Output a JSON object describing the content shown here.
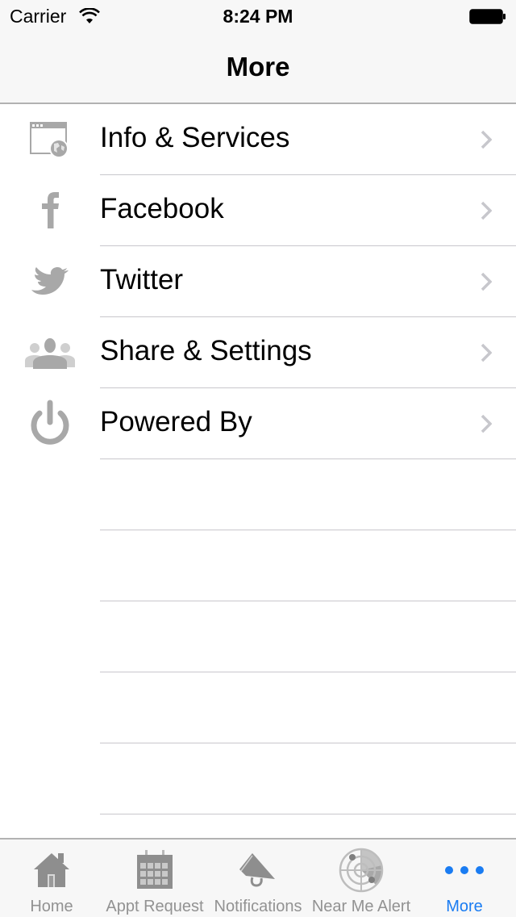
{
  "status_bar": {
    "carrier": "Carrier",
    "time": "8:24 PM",
    "wifi_icon": "wifi-icon",
    "battery_icon": "battery-icon"
  },
  "nav": {
    "title": "More"
  },
  "menu": {
    "items": [
      {
        "label": "Info & Services",
        "icon": "browser-globe-icon"
      },
      {
        "label": "Facebook",
        "icon": "facebook-icon"
      },
      {
        "label": "Twitter",
        "icon": "twitter-bird-icon"
      },
      {
        "label": "Share & Settings",
        "icon": "people-group-icon"
      },
      {
        "label": "Powered By",
        "icon": "power-icon"
      }
    ],
    "chevron_icon": "chevron-right-icon"
  },
  "tab_bar": {
    "tabs": [
      {
        "label": "Home",
        "icon": "house-icon",
        "active": false
      },
      {
        "label": "Appt Request",
        "icon": "calendar-icon",
        "active": false
      },
      {
        "label": "Notifications",
        "icon": "megaphone-icon",
        "active": false
      },
      {
        "label": "Near Me Alert",
        "icon": "radar-icon",
        "active": false
      },
      {
        "label": "More",
        "icon": "more-dots-icon",
        "active": true
      }
    ]
  },
  "colors": {
    "accent": "#1a7cf2",
    "icon_gray": "#a8a8a8",
    "tab_gray": "#929292",
    "separator": "#c8c7cc",
    "bar_background": "#f7f7f7"
  }
}
